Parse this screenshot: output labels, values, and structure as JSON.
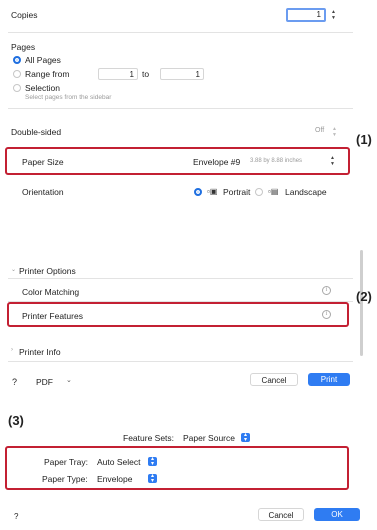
{
  "panel1": {
    "copies_label": "Copies",
    "copies_value": "1",
    "pages_label": "Pages",
    "all_pages": "All Pages",
    "range_from": "Range from",
    "range_from_value": "1",
    "range_to": "to",
    "range_to_value": "1",
    "selection": "Selection",
    "selection_hint": "Select pages from the sidebar",
    "double_sided": "Double-sided",
    "double_sided_value": "Off",
    "paper_size_label": "Paper Size",
    "paper_size_value": "Envelope #9",
    "paper_size_dims": "3.88 by 8.88 inches",
    "orientation_label": "Orientation",
    "portrait": "Portrait",
    "landscape": "Landscape",
    "callout": "(1)"
  },
  "panel2": {
    "printer_options": "Printer Options",
    "color_matching": "Color Matching",
    "printer_features": "Printer Features",
    "printer_info": "Printer Info",
    "help": "?",
    "pdf": "PDF",
    "cancel": "Cancel",
    "print": "Print",
    "callout": "(2)"
  },
  "panel3": {
    "callout": "(3)",
    "feature_sets_label": "Feature Sets:",
    "feature_sets_value": "Paper Source",
    "paper_tray_label": "Paper Tray:",
    "paper_tray_value": "Auto Select",
    "paper_type_label": "Paper Type:",
    "paper_type_value": "Envelope",
    "help": "?",
    "cancel": "Cancel",
    "ok": "OK"
  },
  "colors": {
    "highlight": "#c32033",
    "accent": "#2f7cf2"
  }
}
